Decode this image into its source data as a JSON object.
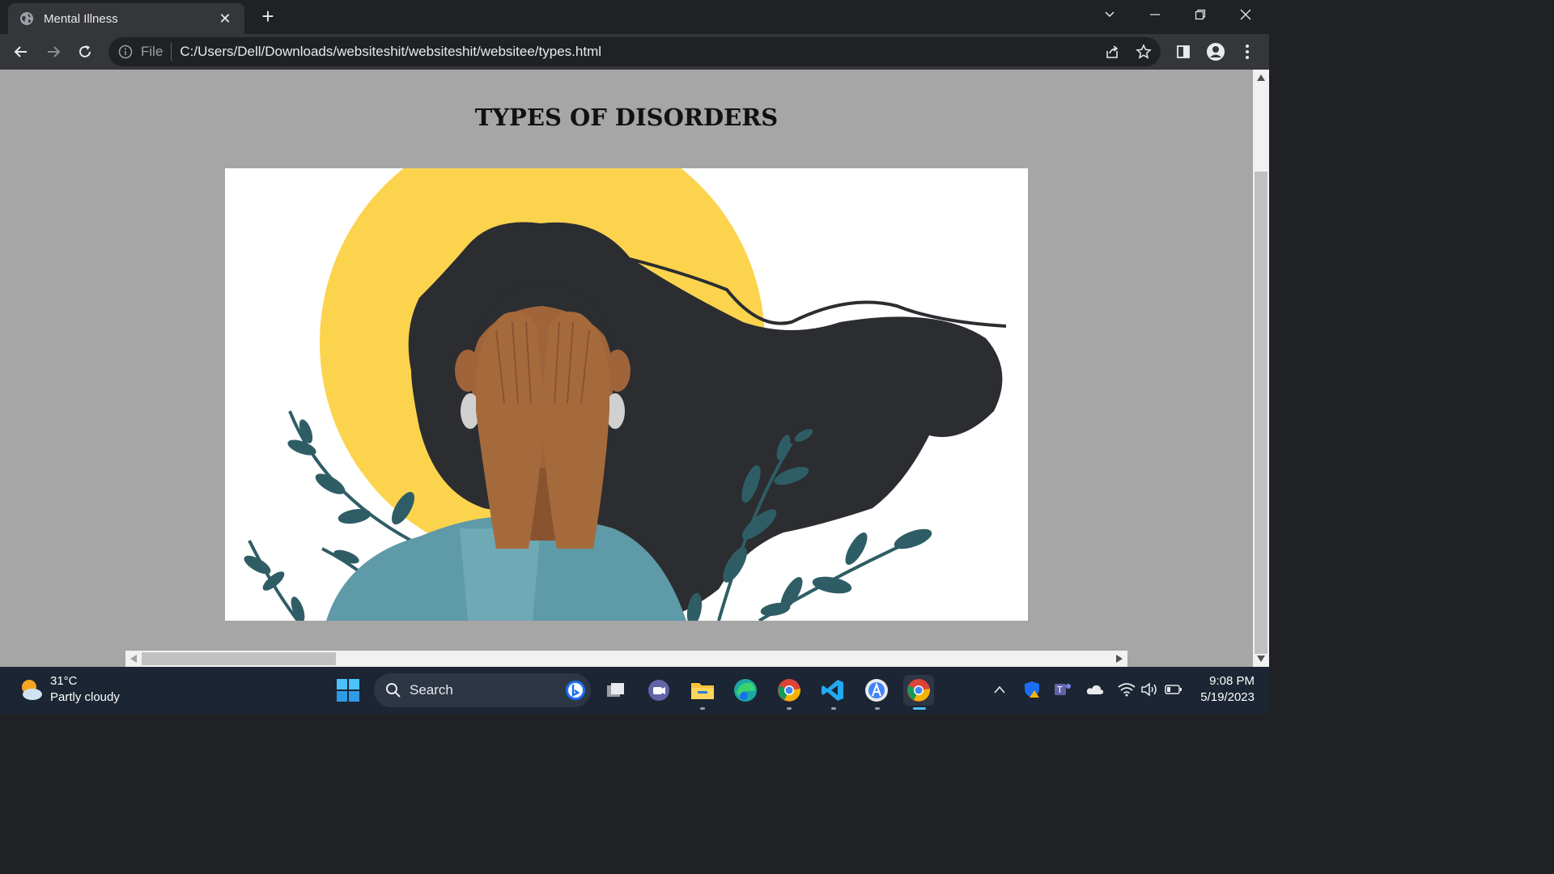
{
  "browser": {
    "tab_title": "Mental Illness",
    "new_tab": "+",
    "scheme_label": "File",
    "url": "C:/Users/Dell/Downloads/websiteshit/websiteshit/websitee/types.html"
  },
  "page": {
    "heading": "TYPES OF DISORDERS"
  },
  "taskbar": {
    "temperature": "31°C",
    "weather_desc": "Partly cloudy",
    "search_placeholder": "Search",
    "time": "9:08 PM",
    "date": "5/19/2023"
  },
  "colors": {
    "page_bg": "#a6a6a6",
    "sun": "#fcd34d",
    "hair": "#2b2d31",
    "skin": "#a0643a",
    "shirt": "#5e9aa8",
    "leaf": "#2f5d66"
  }
}
